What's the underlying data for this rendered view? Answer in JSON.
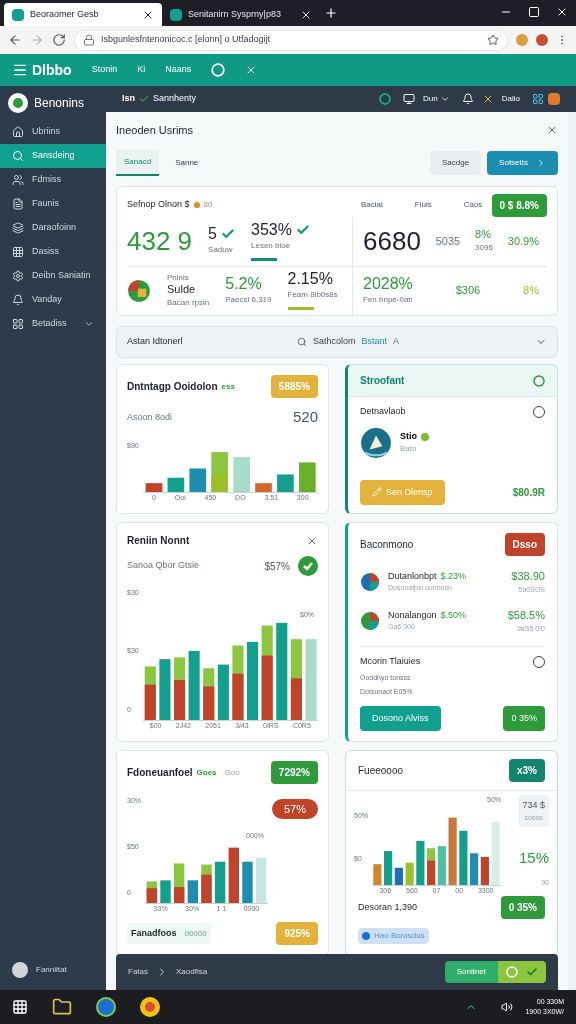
{
  "browser": {
    "tabs": [
      {
        "title": "Beoraomer Gesb",
        "selected": true
      },
      {
        "title": "Senitanirn Sysprny|p83",
        "selected": false
      }
    ],
    "address": "Isbgunlesfntenonicoc.c [elonn] o Utfadogijt"
  },
  "app_header": {
    "brand": "Dlbbo",
    "nav": [
      "Stonin",
      "Ki",
      "Naans"
    ]
  },
  "sidebar": {
    "brand": "Benonins",
    "items": [
      {
        "label": "Ubriins",
        "selected": false,
        "expandable": false
      },
      {
        "label": "Sansdeing",
        "selected": true,
        "expandable": false
      },
      {
        "label": "Fdmiss",
        "selected": false,
        "expandable": false
      },
      {
        "label": "Faunis",
        "selected": false,
        "expandable": false
      },
      {
        "label": "Daraofoinn",
        "selected": false,
        "expandable": false
      },
      {
        "label": "Dasiss",
        "selected": false,
        "expandable": false
      },
      {
        "label": "Deibn Saniatin",
        "selected": false,
        "expandable": false
      },
      {
        "label": "Vanday",
        "selected": false,
        "expandable": false
      },
      {
        "label": "Betadiss",
        "selected": false,
        "expandable": true
      }
    ],
    "user": "Fanniitat"
  },
  "topbar": {
    "breadcrumb": [
      "Isn",
      "Sannhenty"
    ],
    "menu": "Dun",
    "account": "Daiio"
  },
  "panel": {
    "title": "Ineoden Usrims",
    "tabs": [
      {
        "label": "Sanacd",
        "selected": true
      },
      {
        "label": "Sanne",
        "selected": false
      }
    ],
    "buttons": [
      {
        "label": "Sacdge",
        "kind": "secondary"
      },
      {
        "label": "Sotsetts",
        "kind": "primary"
      }
    ]
  },
  "summary": {
    "title": "Sefnop Olnon $",
    "note": "80",
    "right_labels": [
      "Bacial",
      "Fiuis",
      "Caos"
    ],
    "badge": "0 $ 8.8%",
    "rows": [
      {
        "left": [
          {
            "value": "432 9",
            "kind": "headline",
            "check": false
          },
          {
            "value": "5",
            "sub": "Saduw",
            "kind": "metric",
            "check": true
          },
          {
            "value": "353%",
            "sub": "Lesen bioe",
            "kind": "metric",
            "check": true,
            "color": "#0f8f7a"
          }
        ],
        "right": [
          {
            "value": "6680",
            "kind": "figure",
            "check": false
          },
          {
            "value": "5035",
            "kind": "minor",
            "check": false
          },
          {
            "value": "8%",
            "sub": "3096",
            "kind": "smallgain",
            "check": false
          },
          {
            "value": "30.9%",
            "kind": "smallgain",
            "check": false
          }
        ]
      },
      {
        "left": [
          {
            "label": "Pnlnis",
            "value": "Sulde",
            "sub": "Bacan rpsin",
            "kind": "label",
            "check": false
          },
          {
            "value": "5.2%",
            "sub": "Paecsl 6,319",
            "kind": "gain",
            "check": false
          },
          {
            "value": "2.15%",
            "sub": "Feam 8ib0s8s",
            "kind": "metric",
            "check": false,
            "color": "#9cbf2a"
          }
        ],
        "right": [
          {
            "value": "2028%",
            "sub": "Fen bnpe-0ab",
            "kind": "gain",
            "check": false
          },
          {
            "value": "$306",
            "kind": "smallgain",
            "check": false
          },
          {
            "value": "8%",
            "kind": "lime",
            "check": false
          }
        ]
      }
    ]
  },
  "section": {
    "title": "Astan Idtonerl",
    "filter": "Sathcolom",
    "link": "Bstant",
    "suffix": "A"
  },
  "card_rows": [
    {
      "cards": [
        {
          "kind": "chart",
          "title": "Dntntagp Ooidolon",
          "title_tag": "ess",
          "badge": "5885%",
          "color": "#e2b23a",
          "subtitle": "Asoon 8odi",
          "value": "520",
          "y_labels": [
            "$90"
          ],
          "x_labels": [
            "0",
            "Ooi",
            "450",
            "DO",
            "3.51",
            "300"
          ]
        },
        {
          "kind": "profile",
          "title": "Stroofant",
          "row_label": "Detnavlaob",
          "selected": false,
          "name": "Stio",
          "sub": "Bato",
          "button": "Sen Dlensp",
          "amount": "$80.9R"
        }
      ]
    },
    {
      "cards": [
        {
          "kind": "chart",
          "title": "Reniin Nonnt",
          "closable": true,
          "subtitle": "Sanoa Qbor Gtsie",
          "value": "$57%",
          "top_label": "$0%",
          "y_labels": [
            "$30",
            "$30",
            "0"
          ],
          "x_labels": [
            "$00",
            "2J42",
            "2051",
            "3/43",
            "0IRS",
            "C0R5"
          ]
        },
        {
          "kind": "ranking",
          "title": "Baconmono",
          "badge": "Dsso",
          "color": "#c0432a",
          "items": [
            {
              "name": "Dutanlonbpt",
              "change": "$.23%",
              "sub": "Dosnoafpsi ounbosn",
              "amount": "$38.90",
              "amount_sub": "5a0SOS"
            },
            {
              "name": "Nonalangon",
              "change": "$.50%",
              "sub": "Ga6 000",
              "amount": "$58.5%",
              "amount_sub": "9aS5 0/0"
            }
          ],
          "section": "Mcorin Tlaiuies",
          "selected": false,
          "lines": [
            "Ooddnyo tonsss",
            "Dotsunaot E05%"
          ],
          "buttons": [
            "Dosono Alviss",
            "0 35%"
          ]
        }
      ]
    },
    {
      "cards": [
        {
          "kind": "chart",
          "title": "Fdoneuanfoel",
          "title_tag": "Goes",
          "title_note": "Goo",
          "badge": "7292%",
          "color": "#2e9b3a",
          "pill": "57%",
          "top_label": "000%",
          "y_labels": [
            "30%",
            "$50",
            "0"
          ],
          "x_labels": [
            "33%",
            "30%",
            "1 1",
            "0000"
          ],
          "footer": "Fanadfoos",
          "footer_note": "00000",
          "footer_badge": "925%"
        },
        {
          "kind": "chart_side",
          "title": "Fueeoooo",
          "badge": "x3%",
          "color": "#12856f",
          "top_label": "50%",
          "y_labels": [
            "50%",
            "$0"
          ],
          "x_labels": [
            "306",
            "560",
            "07",
            "00",
            "3300"
          ],
          "side_value": "734 $",
          "side_sub": "sosos",
          "big": "15%",
          "big_sub": "90",
          "total": "Desoran 1,390",
          "chip": "Hao Borosdus",
          "footer_badge": "0 35%"
        }
      ]
    }
  ],
  "footer": {
    "breadcrumb": [
      "Fatas",
      "Xaodfisa"
    ],
    "button": "Sonitnet"
  },
  "taskbar": {
    "time": "00 330M",
    "date": "1900 3X0W/"
  }
}
